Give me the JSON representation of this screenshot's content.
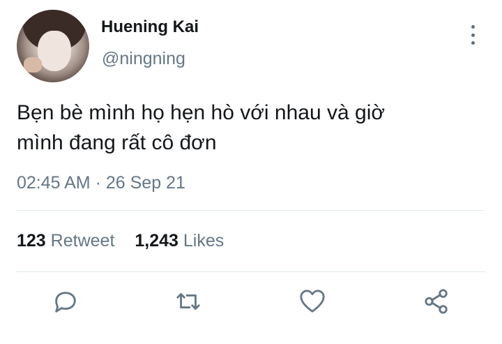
{
  "user": {
    "name": "Huening Kai",
    "handle": "@ningning"
  },
  "tweet": {
    "text_lines": [
      "Bẹn bè mình họ hẹn hò với nhau và giờ",
      "mình đang rất cô đơn"
    ],
    "time": "02:45 AM",
    "separator": "·",
    "date": "26 Sep 21"
  },
  "stats": {
    "retweets_count": "123",
    "retweets_label": "Retweet",
    "likes_count": "1,243",
    "likes_label": "Likes"
  },
  "actions": [
    "reply-icon",
    "retweet-icon",
    "like-icon",
    "share-icon"
  ],
  "colors": {
    "text": "#14171a",
    "secondary": "#657786",
    "divider": "#e1e8ed",
    "icon": "#657786"
  }
}
